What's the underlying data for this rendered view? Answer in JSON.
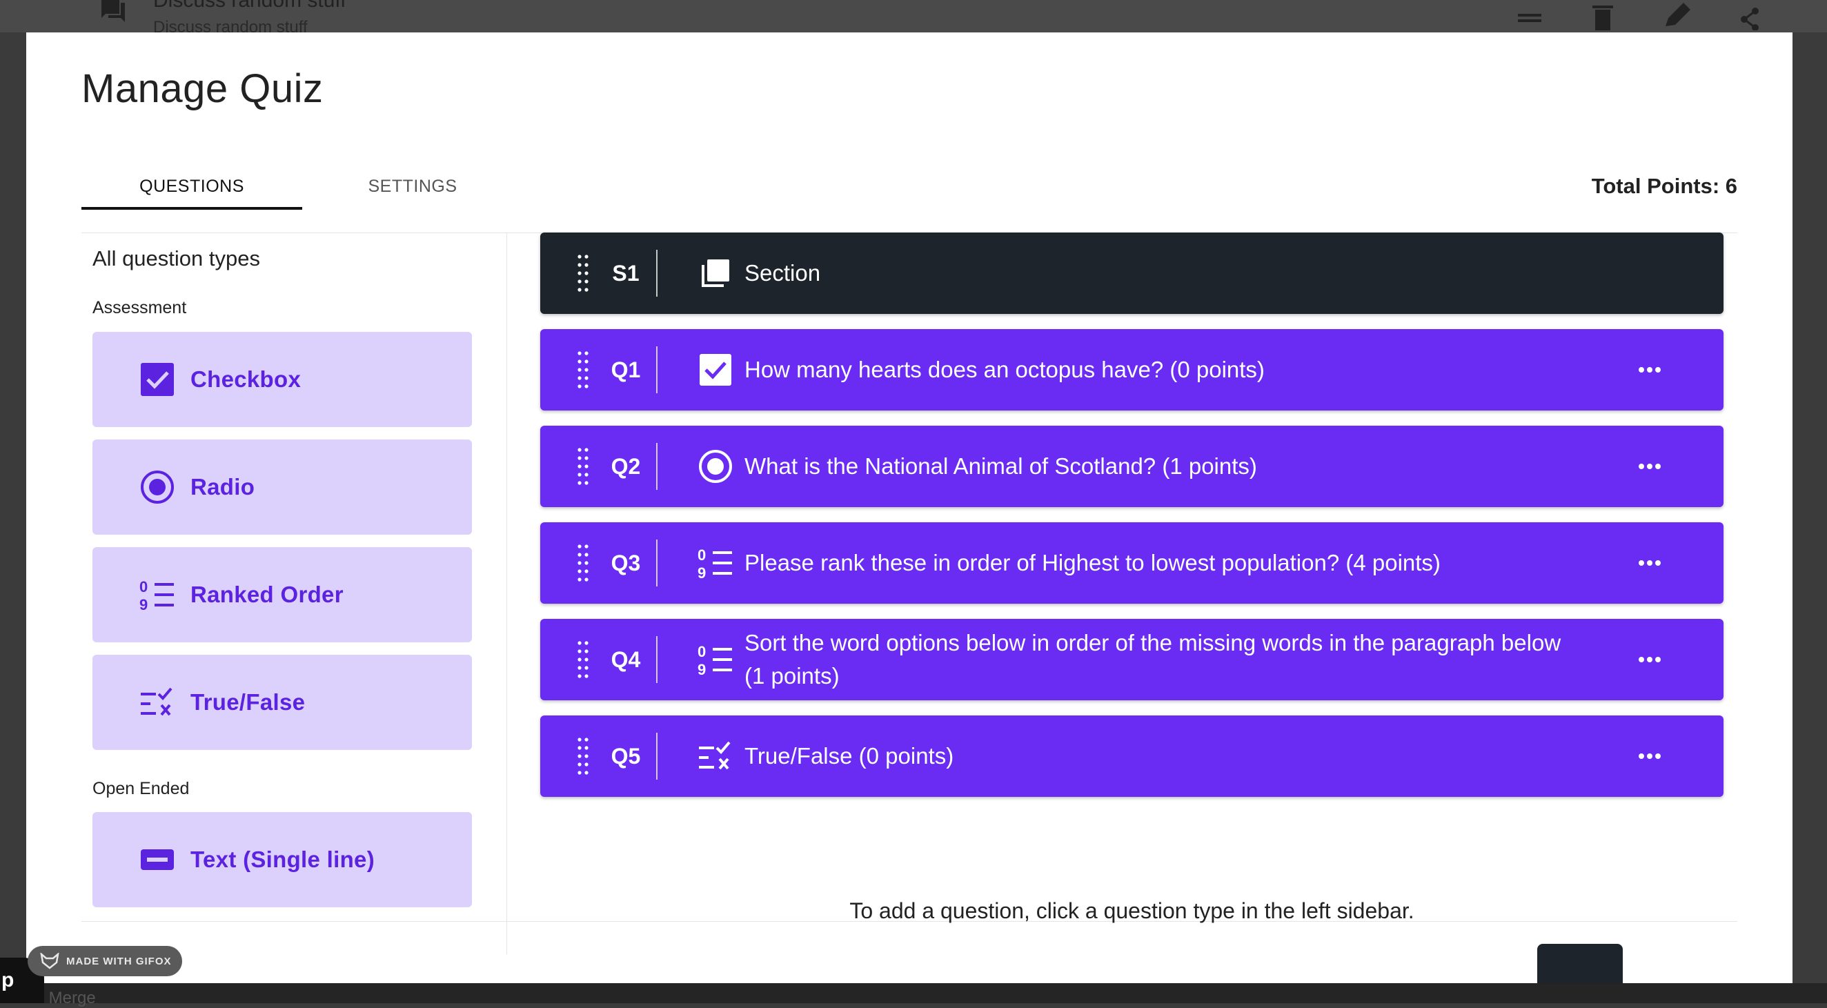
{
  "background": {
    "title": "Discuss random stuff",
    "subtitle": "Discuss random stuff",
    "footer_text": "nt Merge",
    "badge": "p"
  },
  "watermark": "MADE WITH GIFOX",
  "modal": {
    "title": "Manage Quiz",
    "tabs": [
      {
        "label": "QUESTIONS",
        "active": true
      },
      {
        "label": "SETTINGS",
        "active": false
      }
    ],
    "total_points": "Total Points: 6"
  },
  "sidebar": {
    "heading": "All question types",
    "groups": [
      {
        "label": "Assessment",
        "items": [
          {
            "label": "Checkbox",
            "icon": "checkbox-icon"
          },
          {
            "label": "Radio",
            "icon": "radio-icon"
          },
          {
            "label": "Ranked Order",
            "icon": "ranked-order-icon"
          },
          {
            "label": "True/False",
            "icon": "true-false-icon"
          }
        ]
      },
      {
        "label": "Open Ended",
        "items": [
          {
            "label": "Text (Single line)",
            "icon": "text-single-line-icon"
          }
        ]
      }
    ]
  },
  "questions": [
    {
      "num": "S1",
      "text": "Section",
      "icon": "section-icon",
      "type": "section"
    },
    {
      "num": "Q1",
      "text": "How many hearts does an octopus have? (0 points)",
      "icon": "checkbox-icon"
    },
    {
      "num": "Q2",
      "text": "What is the National Animal of Scotland? (1 points)",
      "icon": "radio-icon"
    },
    {
      "num": "Q3",
      "text": "Please rank these in order of Highest to lowest population? (4 points)",
      "icon": "ranked-order-icon"
    },
    {
      "num": "Q4",
      "text": "Sort the word options below in order of the missing words in the paragraph below (1 points)",
      "icon": "ranked-order-icon"
    },
    {
      "num": "Q5",
      "text": "True/False (0 points)",
      "icon": "true-false-icon"
    }
  ],
  "hint": "To add a question, click a question type in the left sidebar.",
  "colors": {
    "accent": "#6a2bf3",
    "accent_text": "#5b22e0",
    "card_bg": "#dcd1fd",
    "section_bg": "#1d242c"
  }
}
